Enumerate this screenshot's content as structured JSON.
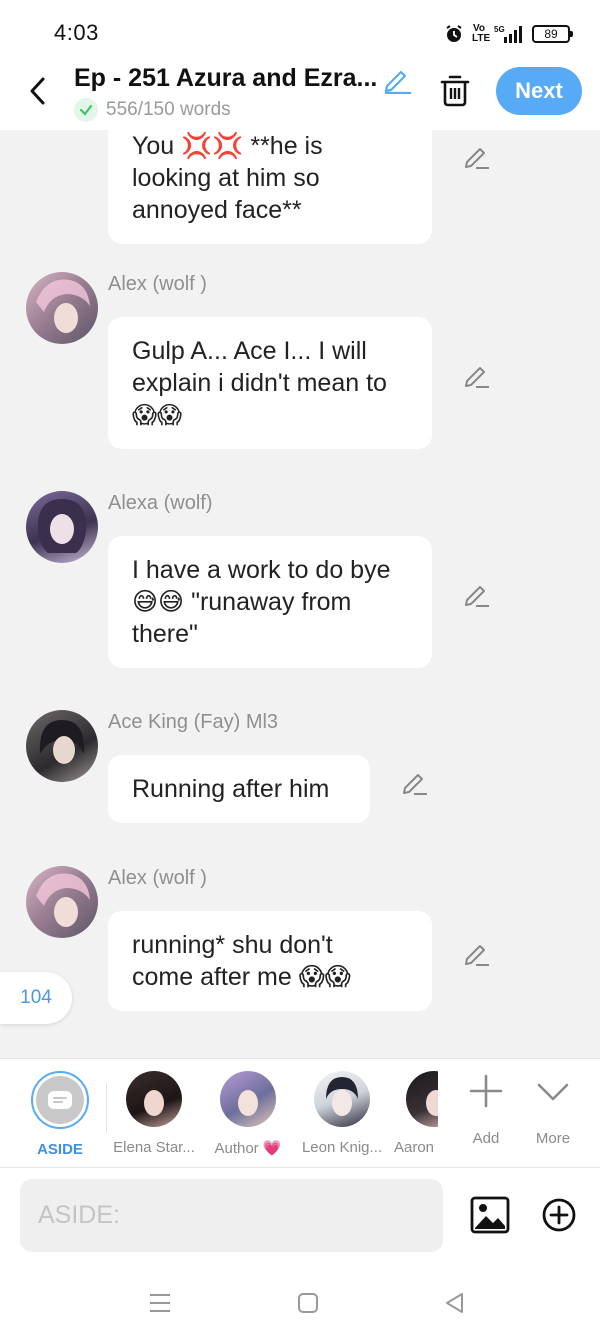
{
  "status_bar": {
    "time": "4:03",
    "network_label": "Vo\nLTE",
    "network_type": "5G",
    "battery": "89"
  },
  "header": {
    "title": "Ep - 251 Azura and Ezra...",
    "word_count": "556/150 words",
    "next_label": "Next"
  },
  "messages": [
    {
      "speaker": "",
      "lines": [
        "You 💢💢 **he is",
        "looking at him so",
        "annoyed face**"
      ]
    },
    {
      "speaker": "Alex (wolf )",
      "lines": [
        "Gulp A... Ace I... I will",
        "explain i didn't mean to",
        "😱😱"
      ]
    },
    {
      "speaker": "Alexa (wolf)",
      "lines": [
        "I have a work to do bye",
        "😅😅 \"runaway from",
        "there\""
      ]
    },
    {
      "speaker": "Ace King (Fay) Ml3",
      "lines": [
        "Running after him"
      ]
    },
    {
      "speaker": "Alex (wolf )",
      "lines": [
        "running* shu don't",
        "come after me 😱😱"
      ]
    }
  ],
  "message_count": "104",
  "characters": [
    {
      "label": "ASIDE"
    },
    {
      "label": "Elena Star..."
    },
    {
      "label": "Author 💗"
    },
    {
      "label": "Leon Knig..."
    },
    {
      "label": "Aaron"
    }
  ],
  "tools": {
    "add_label": "Add",
    "more_label": "More"
  },
  "input": {
    "placeholder": "ASIDE:"
  },
  "colors": {
    "accent": "#57aaf5",
    "aside_label": "#3f8fe6",
    "check_green": "#3cc46a",
    "background": "#f2f2f2"
  },
  "icons": {
    "back": "chevron-left-icon",
    "edit": "pencil-icon",
    "delete": "trash-icon",
    "check": "check-icon",
    "add": "plus-icon",
    "more": "chevron-down-icon",
    "image": "image-icon",
    "add_circle": "plus-circle-icon"
  }
}
